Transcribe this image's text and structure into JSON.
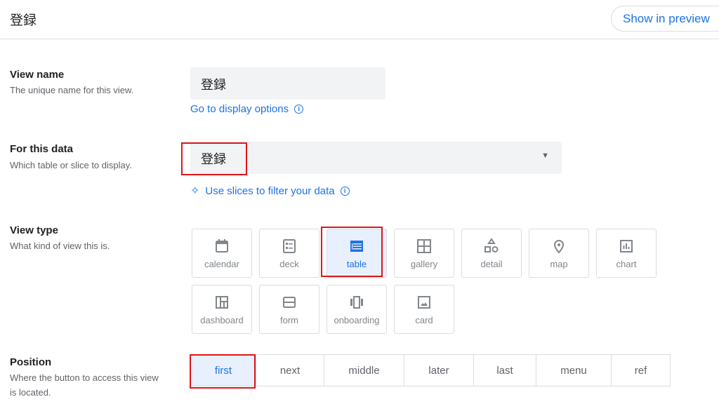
{
  "header": {
    "title": "登録",
    "preview_button": "Show in preview"
  },
  "view_name": {
    "label": "View name",
    "description": "The unique name for this view.",
    "value": "登録",
    "link": "Go to display options"
  },
  "for_this_data": {
    "label": "For this data",
    "description": "Which table or slice to display.",
    "value": "登録",
    "link": "Use slices to filter your data"
  },
  "view_type": {
    "label": "View type",
    "description": "What kind of view this is.",
    "selected": "table",
    "options": [
      "calendar",
      "deck",
      "table",
      "gallery",
      "detail",
      "map",
      "chart",
      "dashboard",
      "form",
      "onboarding",
      "card"
    ]
  },
  "position": {
    "label": "Position",
    "description": "Where the button to access this view is located.",
    "selected": "first",
    "options": [
      "first",
      "next",
      "middle",
      "later",
      "last",
      "menu",
      "ref"
    ]
  },
  "colors": {
    "accent": "#1a73e8",
    "selected_bg": "#e8f0fe",
    "highlight": "#e0141b"
  }
}
